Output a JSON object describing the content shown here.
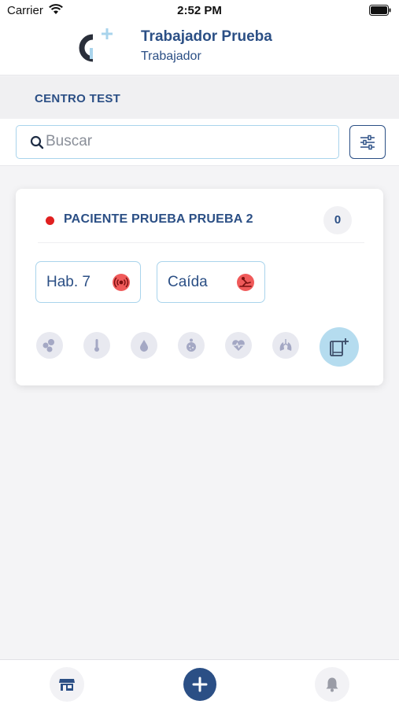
{
  "status_bar": {
    "carrier": "Carrier",
    "time": "2:52 PM"
  },
  "header": {
    "user_name": "Trabajador Prueba",
    "user_role": "Trabajador"
  },
  "center": {
    "title": "CENTRO TEST"
  },
  "search": {
    "placeholder": "Buscar",
    "value": ""
  },
  "patient_card": {
    "name": "PACIENTE PRUEBA PRUEBA 2",
    "status_color": "#e02020",
    "count": "0",
    "chips": [
      {
        "label": "Hab. 7",
        "icon": "alarm-signal-icon"
      },
      {
        "label": "Caída",
        "icon": "fall-icon"
      }
    ],
    "metric_icons": [
      "cells-icon",
      "thermometer-icon",
      "drop-icon",
      "glucose-icon",
      "heart-rate-icon",
      "lungs-icon"
    ],
    "action_icon": "add-record-icon"
  },
  "bottom_nav": {
    "items": [
      "store-icon",
      "add-icon",
      "bell-icon"
    ]
  },
  "colors": {
    "primary": "#2b4f85",
    "accent": "#a9d4ec",
    "alert": "#f05a5a"
  }
}
